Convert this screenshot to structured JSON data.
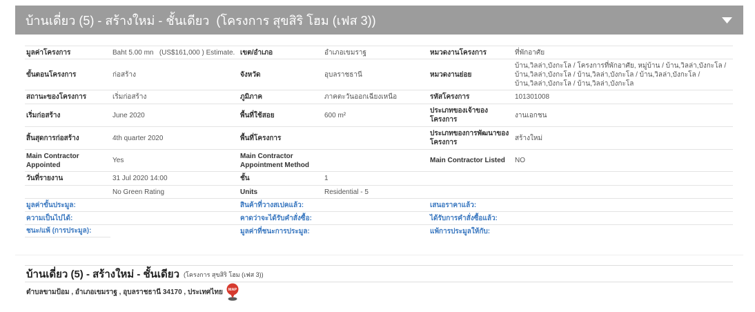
{
  "header": {
    "title": "บ้านเดี่ยว (5) - สร้างใหม่ - ชั้นเดียว  (โครงการ สุขสิริ โฮม (เฟส 3))",
    "toggle_icon": "caret-down-icon"
  },
  "details": {
    "rows": [
      [
        {
          "label": "มูลค่าโครงการ",
          "value": "Baht 5.00 mn   (US$161,000 ) Estimate."
        },
        {
          "label": "เขต/อำเภอ",
          "value": "อำเภอเขมราฐ"
        },
        {
          "label": "หมวดงานโครงการ",
          "value": "ที่พักอาศัย"
        }
      ],
      [
        {
          "label": "ขั้นตอนโครงการ",
          "value": "ก่อสร้าง"
        },
        {
          "label": "จังหวัด",
          "value": "อุบลราชธานี"
        },
        {
          "label": "หมวดงานย่อย",
          "value_lines": [
            "บ้าน,วิลล่า,บังกะโล / โครงการที่พักอาศัย, หมู่บ้าน / บ้าน,วิลล่า,บังกะโล /",
            "บ้าน,วิลล่า,บังกะโล / บ้าน,วิลล่า,บังกะโล / บ้าน,วิลล่า,บังกะโล /",
            "บ้าน,วิลล่า,บังกะโล / บ้าน,วิลล่า,บังกะโล"
          ]
        }
      ],
      [
        {
          "label": "สถานะของโครงการ",
          "value": "เริ่มก่อสร้าง"
        },
        {
          "label": "ภูมิภาค",
          "value": "ภาคตะวันออกเฉียงเหนือ"
        },
        {
          "label": "รหัสโครงการ",
          "value": "101301008"
        }
      ],
      [
        {
          "label": "เริ่มก่อสร้าง",
          "value": "June 2020"
        },
        {
          "label": "พื้นที่ใช้สอย",
          "value": "600 m²"
        },
        {
          "label": "ประเภทของเจ้าของโครงการ",
          "value": "งานเอกชน"
        }
      ],
      [
        {
          "label": "สิ้นสุดการก่อสร้าง",
          "value": "4th quarter 2020"
        },
        {
          "label": "พื้นที่โครงการ"
        },
        {
          "label": "ประเภทของการพัฒนาของโครงการ",
          "value": "สร้างใหม่"
        }
      ],
      [
        {
          "label": "Main Contractor Appointed",
          "value": "Yes"
        },
        {
          "label": "Main Contractor Appointment Method"
        },
        {
          "label": "Main Contractor Listed",
          "value": "NO"
        }
      ],
      [
        {
          "label": "วันที่รายงาน",
          "value": "31 Jul 2020 14:00"
        },
        {
          "label": "ชั้น",
          "value": "1"
        },
        {}
      ],
      [
        {
          "value": "No Green Rating"
        },
        {
          "label": "Units",
          "value": "Residential - 5"
        },
        {}
      ]
    ]
  },
  "tender_links": [
    [
      "มูลค่าขั้นประมูล:",
      "สินค้าที่วางสเปคแล้ว:",
      "เสนอราคาแล้ว:"
    ],
    [
      "ความเป็นไปได้:",
      "คาดว่าจะได้รับคำสั่งซื้อ:",
      "ได้รับการคำสั่งซื้อแล้ว:"
    ],
    [
      "ชนะ/แพ้ (การประมูล):",
      "มูลค่าที่ชนะการประมูล:",
      "แพ้การประมูลให้กับ:"
    ]
  ],
  "summary": {
    "title": "บ้านเดี่ยว (5) - สร้างใหม่ - ชั้นเดียว",
    "project_name": "(โครงการ สุขสิริ โฮม (เฟส 3))",
    "address": "ตำบลขามป้อม , อำเภอเขมราฐ , อุบลราชธานี 34170 , ประเทศไทย",
    "map_icon": "map-pin-icon",
    "map_label": "MAP"
  },
  "colors": {
    "header_bg": "#9c9c9c",
    "link": "#3a78c0",
    "map_pin": "#d63b2f"
  }
}
